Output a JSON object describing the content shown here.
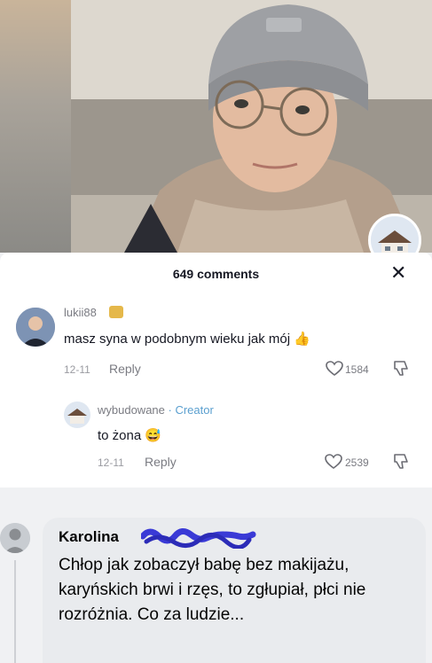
{
  "sheet": {
    "title": "649 comments"
  },
  "comments": [
    {
      "username": "lukii88",
      "text": "masz syna w podobnym wieku jak mój 👍",
      "date": "12-11",
      "reply_label": "Reply",
      "likes": "1584"
    },
    {
      "username": "wybudowane",
      "creator_label": "· Creator",
      "text": "to żona 😅",
      "date": "12-11",
      "reply_label": "Reply",
      "likes": "2539"
    }
  ],
  "fb_comment": {
    "name": "Karolina",
    "text": "Chłop jak zobaczył babę bez makijażu, karyńskich brwi i rzęs, to zgłupiał, płci nie rozróżnia. Co za ludzie..."
  },
  "colors": {
    "creator_accent": "#5a9fcf",
    "name_scribble": "#3a3ad6"
  },
  "icons": [
    "close-icon",
    "heart-icon",
    "dislike-icon",
    "avatar",
    "house-avatar",
    "default-profile-icon"
  ]
}
